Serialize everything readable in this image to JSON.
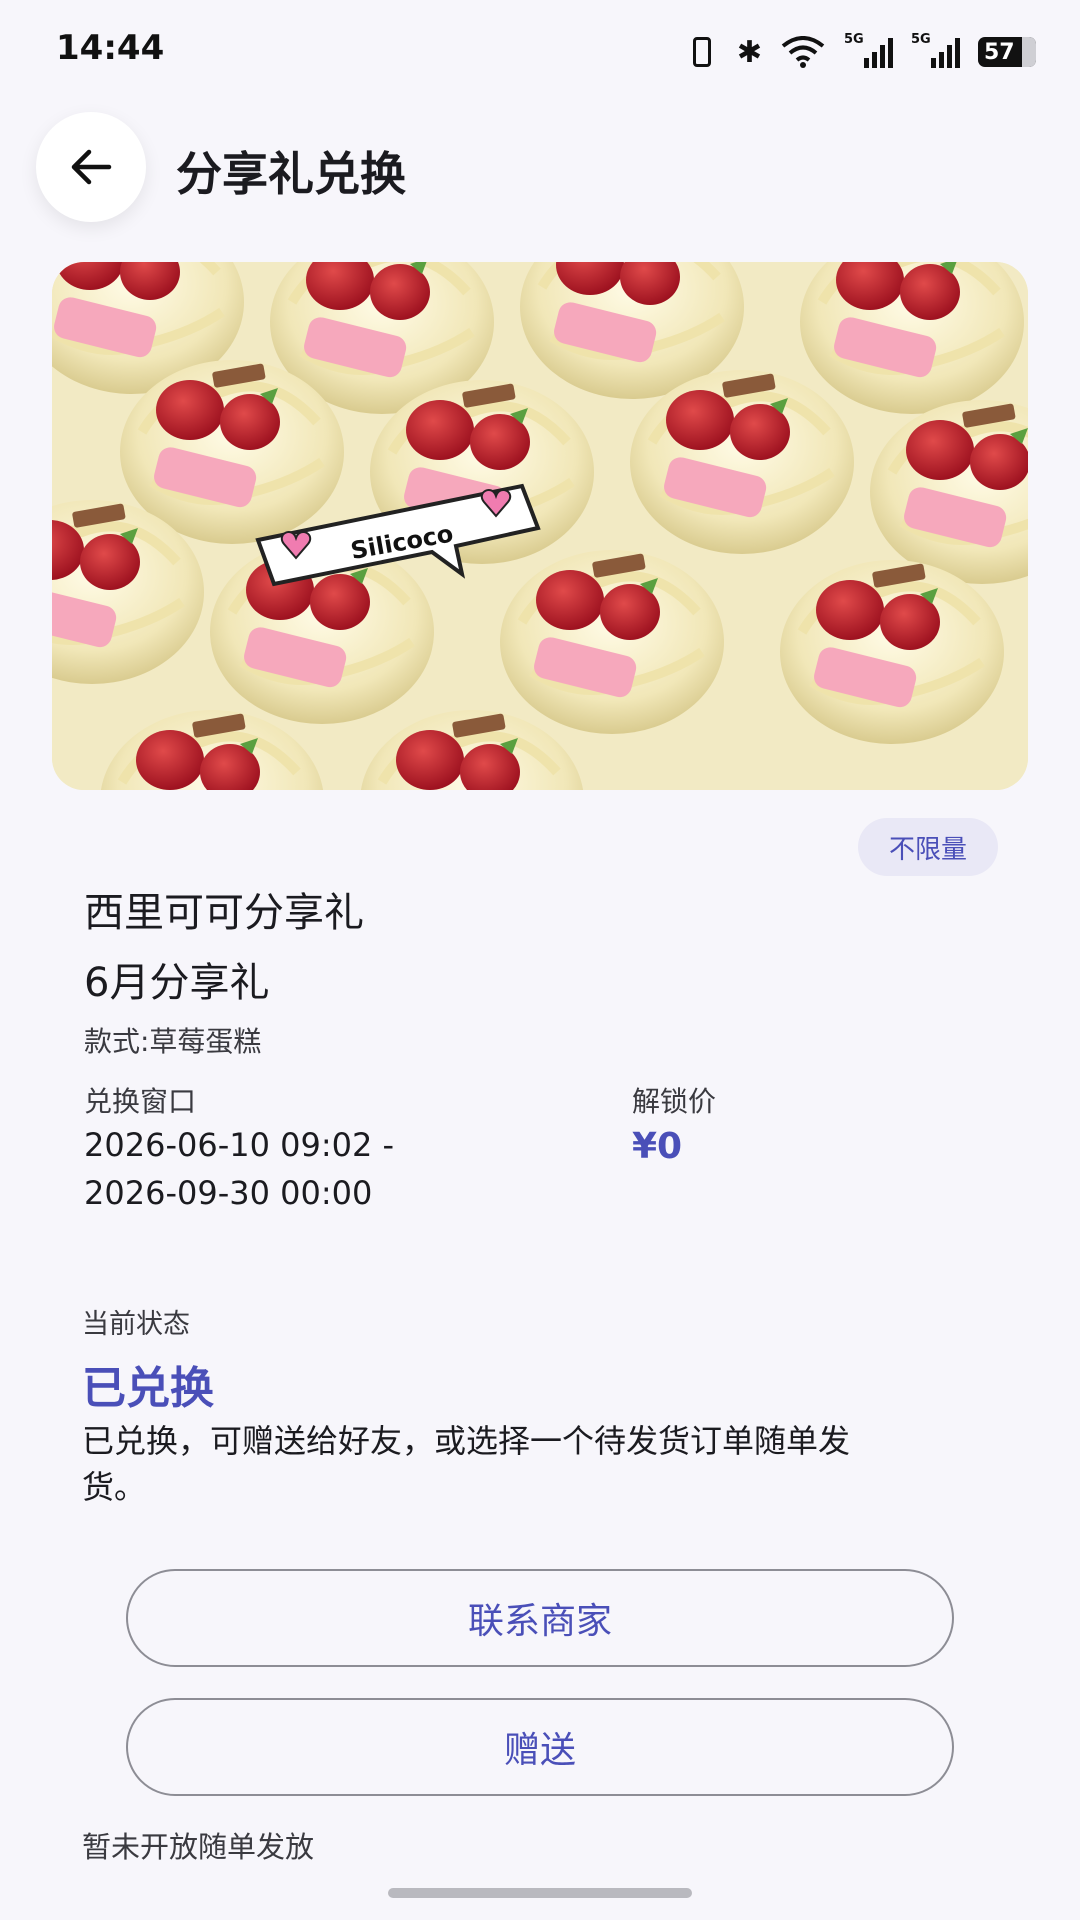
{
  "status_bar": {
    "time": "14:44",
    "battery": "57",
    "network_tags": [
      "5G",
      "5G"
    ],
    "icons": [
      "vibrate-icon",
      "bluetooth-icon",
      "wifi-icon",
      "signal-icon",
      "signal-icon",
      "battery-icon"
    ]
  },
  "header": {
    "back_icon": "arrow-left-icon",
    "title": "分享礼兑换"
  },
  "hero": {
    "sticker_text": "Silicoco"
  },
  "gift": {
    "badge": "不限量",
    "name": "西里可可分享礼",
    "subtitle": "6月分享礼",
    "style": "款式:草莓蛋糕"
  },
  "window": {
    "label": "兑换窗口",
    "start": "2026-06-10 09:02 -",
    "end": "2026-09-30 00:00"
  },
  "price": {
    "label": "解锁价",
    "value": "¥0"
  },
  "status": {
    "label": "当前状态",
    "value": "已兑换",
    "description": "已兑换，可赠送给好友，或选择一个待发货订单随单发货。"
  },
  "actions": {
    "contact_label": "联系商家",
    "gift_label": "赠送"
  },
  "footer_note": "暂未开放随单发放",
  "colors": {
    "accent": "#4a4fb8",
    "background": "#f7f6fb",
    "badge_bg": "#e9e8f6"
  }
}
